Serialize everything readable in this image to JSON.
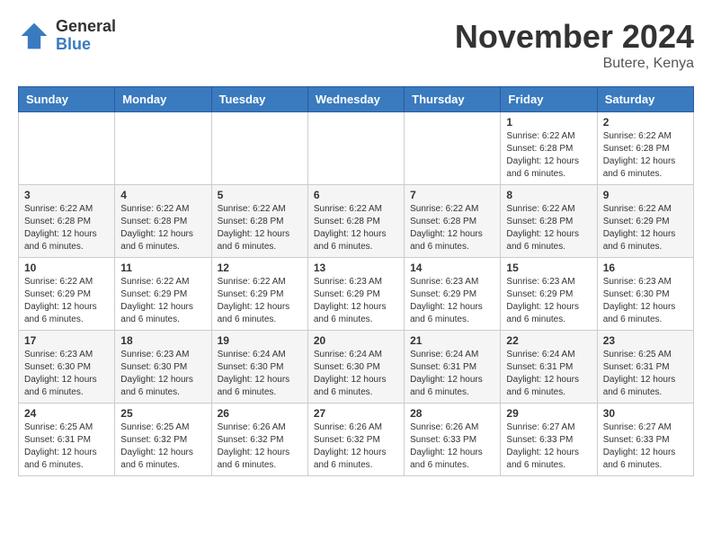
{
  "logo": {
    "general": "General",
    "blue": "Blue"
  },
  "title": "November 2024",
  "location": "Butere, Kenya",
  "days_of_week": [
    "Sunday",
    "Monday",
    "Tuesday",
    "Wednesday",
    "Thursday",
    "Friday",
    "Saturday"
  ],
  "weeks": [
    [
      {
        "day": "",
        "info": ""
      },
      {
        "day": "",
        "info": ""
      },
      {
        "day": "",
        "info": ""
      },
      {
        "day": "",
        "info": ""
      },
      {
        "day": "",
        "info": ""
      },
      {
        "day": "1",
        "info": "Sunrise: 6:22 AM\nSunset: 6:28 PM\nDaylight: 12 hours and 6 minutes."
      },
      {
        "day": "2",
        "info": "Sunrise: 6:22 AM\nSunset: 6:28 PM\nDaylight: 12 hours and 6 minutes."
      }
    ],
    [
      {
        "day": "3",
        "info": "Sunrise: 6:22 AM\nSunset: 6:28 PM\nDaylight: 12 hours and 6 minutes."
      },
      {
        "day": "4",
        "info": "Sunrise: 6:22 AM\nSunset: 6:28 PM\nDaylight: 12 hours and 6 minutes."
      },
      {
        "day": "5",
        "info": "Sunrise: 6:22 AM\nSunset: 6:28 PM\nDaylight: 12 hours and 6 minutes."
      },
      {
        "day": "6",
        "info": "Sunrise: 6:22 AM\nSunset: 6:28 PM\nDaylight: 12 hours and 6 minutes."
      },
      {
        "day": "7",
        "info": "Sunrise: 6:22 AM\nSunset: 6:28 PM\nDaylight: 12 hours and 6 minutes."
      },
      {
        "day": "8",
        "info": "Sunrise: 6:22 AM\nSunset: 6:28 PM\nDaylight: 12 hours and 6 minutes."
      },
      {
        "day": "9",
        "info": "Sunrise: 6:22 AM\nSunset: 6:29 PM\nDaylight: 12 hours and 6 minutes."
      }
    ],
    [
      {
        "day": "10",
        "info": "Sunrise: 6:22 AM\nSunset: 6:29 PM\nDaylight: 12 hours and 6 minutes."
      },
      {
        "day": "11",
        "info": "Sunrise: 6:22 AM\nSunset: 6:29 PM\nDaylight: 12 hours and 6 minutes."
      },
      {
        "day": "12",
        "info": "Sunrise: 6:22 AM\nSunset: 6:29 PM\nDaylight: 12 hours and 6 minutes."
      },
      {
        "day": "13",
        "info": "Sunrise: 6:23 AM\nSunset: 6:29 PM\nDaylight: 12 hours and 6 minutes."
      },
      {
        "day": "14",
        "info": "Sunrise: 6:23 AM\nSunset: 6:29 PM\nDaylight: 12 hours and 6 minutes."
      },
      {
        "day": "15",
        "info": "Sunrise: 6:23 AM\nSunset: 6:29 PM\nDaylight: 12 hours and 6 minutes."
      },
      {
        "day": "16",
        "info": "Sunrise: 6:23 AM\nSunset: 6:30 PM\nDaylight: 12 hours and 6 minutes."
      }
    ],
    [
      {
        "day": "17",
        "info": "Sunrise: 6:23 AM\nSunset: 6:30 PM\nDaylight: 12 hours and 6 minutes."
      },
      {
        "day": "18",
        "info": "Sunrise: 6:23 AM\nSunset: 6:30 PM\nDaylight: 12 hours and 6 minutes."
      },
      {
        "day": "19",
        "info": "Sunrise: 6:24 AM\nSunset: 6:30 PM\nDaylight: 12 hours and 6 minutes."
      },
      {
        "day": "20",
        "info": "Sunrise: 6:24 AM\nSunset: 6:30 PM\nDaylight: 12 hours and 6 minutes."
      },
      {
        "day": "21",
        "info": "Sunrise: 6:24 AM\nSunset: 6:31 PM\nDaylight: 12 hours and 6 minutes."
      },
      {
        "day": "22",
        "info": "Sunrise: 6:24 AM\nSunset: 6:31 PM\nDaylight: 12 hours and 6 minutes."
      },
      {
        "day": "23",
        "info": "Sunrise: 6:25 AM\nSunset: 6:31 PM\nDaylight: 12 hours and 6 minutes."
      }
    ],
    [
      {
        "day": "24",
        "info": "Sunrise: 6:25 AM\nSunset: 6:31 PM\nDaylight: 12 hours and 6 minutes."
      },
      {
        "day": "25",
        "info": "Sunrise: 6:25 AM\nSunset: 6:32 PM\nDaylight: 12 hours and 6 minutes."
      },
      {
        "day": "26",
        "info": "Sunrise: 6:26 AM\nSunset: 6:32 PM\nDaylight: 12 hours and 6 minutes."
      },
      {
        "day": "27",
        "info": "Sunrise: 6:26 AM\nSunset: 6:32 PM\nDaylight: 12 hours and 6 minutes."
      },
      {
        "day": "28",
        "info": "Sunrise: 6:26 AM\nSunset: 6:33 PM\nDaylight: 12 hours and 6 minutes."
      },
      {
        "day": "29",
        "info": "Sunrise: 6:27 AM\nSunset: 6:33 PM\nDaylight: 12 hours and 6 minutes."
      },
      {
        "day": "30",
        "info": "Sunrise: 6:27 AM\nSunset: 6:33 PM\nDaylight: 12 hours and 6 minutes."
      }
    ]
  ]
}
